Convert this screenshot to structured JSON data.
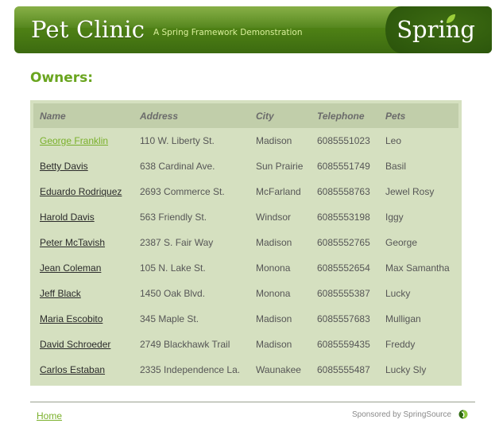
{
  "header": {
    "title": "Pet Clinic",
    "subtitle": "A Spring Framework Demonstration",
    "logo_text": "Spring"
  },
  "page": {
    "heading": "Owners:"
  },
  "table": {
    "columns": [
      "Name",
      "Address",
      "City",
      "Telephone",
      "Pets"
    ],
    "rows": [
      {
        "name": "George Franklin",
        "address": "110 W. Liberty St.",
        "city": "Madison",
        "telephone": "6085551023",
        "pets": "Leo"
      },
      {
        "name": "Betty Davis",
        "address": "638 Cardinal Ave.",
        "city": "Sun Prairie",
        "telephone": "6085551749",
        "pets": "Basil"
      },
      {
        "name": "Eduardo Rodriquez",
        "address": "2693 Commerce St.",
        "city": "McFarland",
        "telephone": "6085558763",
        "pets": "Jewel Rosy"
      },
      {
        "name": "Harold Davis",
        "address": "563 Friendly St.",
        "city": "Windsor",
        "telephone": "6085553198",
        "pets": "Iggy"
      },
      {
        "name": "Peter McTavish",
        "address": "2387 S. Fair Way",
        "city": "Madison",
        "telephone": "6085552765",
        "pets": "George"
      },
      {
        "name": "Jean Coleman",
        "address": "105 N. Lake St.",
        "city": "Monona",
        "telephone": "6085552654",
        "pets": "Max Samantha"
      },
      {
        "name": "Jeff Black",
        "address": "1450 Oak Blvd.",
        "city": "Monona",
        "telephone": "6085555387",
        "pets": "Lucky"
      },
      {
        "name": "Maria Escobito",
        "address": "345 Maple St.",
        "city": "Madison",
        "telephone": "6085557683",
        "pets": "Mulligan"
      },
      {
        "name": "David Schroeder",
        "address": "2749 Blackhawk Trail",
        "city": "Madison",
        "telephone": "6085559435",
        "pets": "Freddy"
      },
      {
        "name": "Carlos Estaban",
        "address": "2335 Independence La.",
        "city": "Waunakee",
        "telephone": "6085555487",
        "pets": "Lucky Sly"
      }
    ]
  },
  "footer": {
    "home_label": "Home",
    "sponsor_text": "Sponsored by SpringSource"
  },
  "colors": {
    "brand_green": "#4f8215",
    "accent_green": "#6aa51f",
    "table_bg": "#d5e0c0",
    "table_header_bg": "#c1ceaa"
  },
  "icons": [
    "spring-leaf-icon",
    "springsource-logo-icon"
  ]
}
